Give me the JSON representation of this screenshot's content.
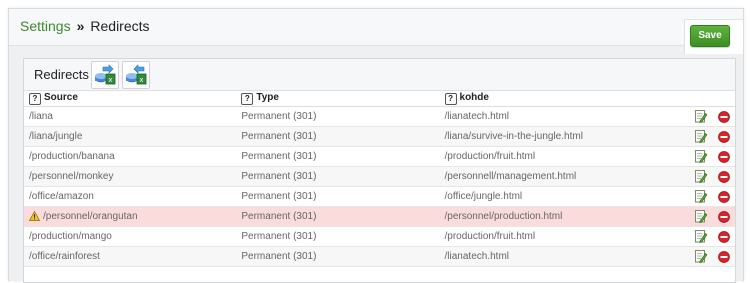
{
  "breadcrumb": {
    "parent": "Settings",
    "separator": "»",
    "current": "Redirects"
  },
  "toolbar": {
    "save_label": "Save"
  },
  "panel": {
    "title": "Redirects"
  },
  "columns": {
    "source": "Source",
    "type": "Type",
    "target": "kohde",
    "help": "?"
  },
  "rows": [
    {
      "source": "/liana",
      "type": "Permanent (301)",
      "target": "/lianatech.html",
      "warning": false
    },
    {
      "source": "/liana/jungle",
      "type": "Permanent (301)",
      "target": "/liana/survive-in-the-jungle.html",
      "warning": false
    },
    {
      "source": "/production/banana",
      "type": "Permanent (301)",
      "target": "/production/fruit.html",
      "warning": false
    },
    {
      "source": "/personnel/monkey",
      "type": "Permanent (301)",
      "target": "/personnell/management.html",
      "warning": false
    },
    {
      "source": "/office/amazon",
      "type": "Permanent (301)",
      "target": "/office/jungle.html",
      "warning": false
    },
    {
      "source": "/personnel/orangutan",
      "type": "Permanent (301)",
      "target": "/personnel/production.html",
      "warning": true
    },
    {
      "source": "/production/mango",
      "type": "Permanent (301)",
      "target": "/production/fruit.html",
      "warning": false
    },
    {
      "source": "/office/rainforest",
      "type": "Permanent (301)",
      "target": "/lianatech.html",
      "warning": false
    }
  ],
  "colors": {
    "accent": "#3c8a2f",
    "warning_row": "#fbdcdc",
    "save_button": "#4ca22f"
  },
  "icons": {
    "import": "import-excel-icon",
    "export": "export-excel-icon",
    "edit": "edit-icon",
    "delete": "delete-icon",
    "warning": "warning-icon",
    "help": "help-icon"
  }
}
